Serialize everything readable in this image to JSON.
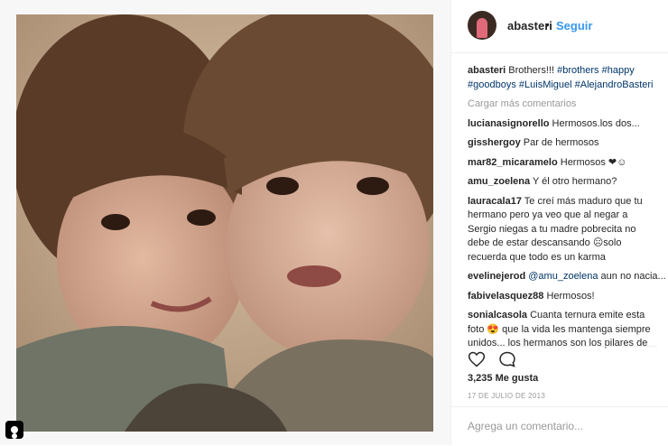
{
  "post": {
    "photo_alt": "",
    "username": "abasteri",
    "follow_label": "Seguir",
    "separator": "•"
  },
  "caption": {
    "username": "abasteri",
    "text": "Brothers!!!",
    "tags": [
      "#brothers",
      "#happy",
      "#goodboys",
      "#LuisMiguel",
      "#AlejandroBasteri"
    ]
  },
  "load_more_label": "Cargar más comentarios",
  "comments": [
    {
      "user": "lucianasignorello",
      "text": "Hermosos.los dos..."
    },
    {
      "user": "gisshergoy",
      "text": "Par de hermosos"
    },
    {
      "user": "mar82_micaramelo",
      "text": "Hermosos ❤☺"
    },
    {
      "user": "amu_zoelena",
      "text": "Y él otro hermano?"
    },
    {
      "user": "lauracala17",
      "text": "Te creí más maduro que tu hermano pero ya veo que al negar a Sergio niegas a tu madre pobrecita no debe de estar descansando ☹solo recuerda que todo es un karma"
    },
    {
      "user": "evelinejerod",
      "mention": "@amu_zoelena",
      "text": "aun no nacia..."
    },
    {
      "user": "fabivelasquez88",
      "text": "Hermosos!"
    },
    {
      "user": "sonialcasola",
      "text": "Cuanta ternura emite esta foto 😍 que la vida les mantenga siempre unidos... los hermanos son los pilares de"
    }
  ],
  "likes_label": "3,235 Me gusta",
  "date_label": "17 DE JULIO DE 2013",
  "add_comment_placeholder": "Agrega un comentario...",
  "colors": {
    "link_blue": "#3897f0",
    "hashtag": "#003569",
    "muted": "#999999",
    "border": "#efefef"
  },
  "icons": [
    "heart-icon",
    "comment-icon",
    "profile-icon"
  ]
}
